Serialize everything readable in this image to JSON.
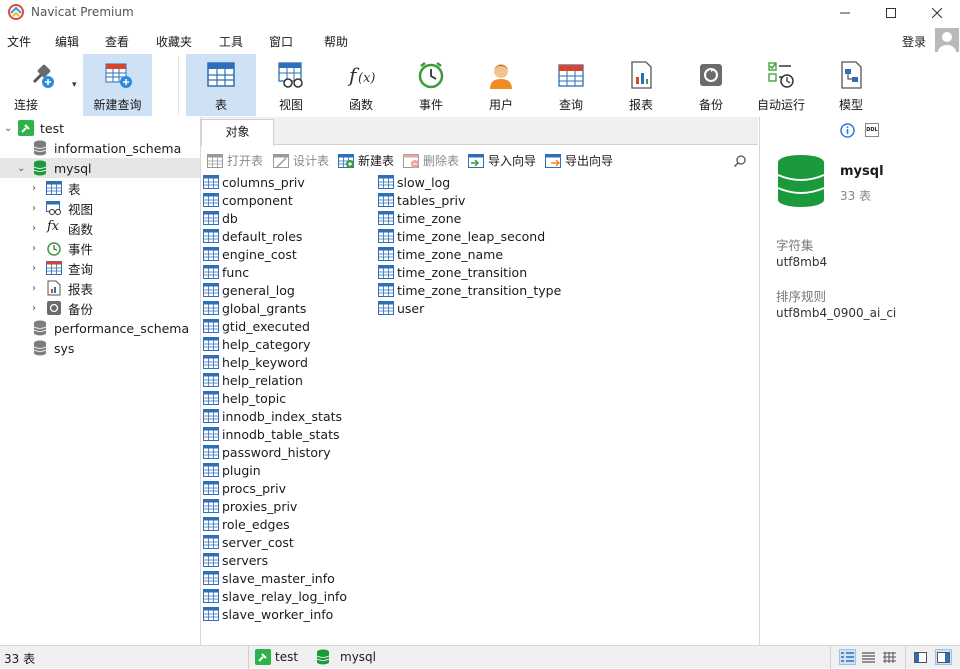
{
  "app": {
    "title": "Navicat Premium"
  },
  "menu": {
    "items": [
      "文件",
      "编辑",
      "查看",
      "收藏夹",
      "工具",
      "窗口",
      "帮助"
    ],
    "login": "登录"
  },
  "toolbar": {
    "connect": "连接",
    "new_query": "新建查询",
    "items": [
      "表",
      "视图",
      "函数",
      "事件",
      "用户",
      "查询",
      "报表",
      "备份",
      "自动运行",
      "模型"
    ]
  },
  "sidebar": {
    "connection": "test",
    "databases": [
      "information_schema",
      "mysql",
      "performance_schema",
      "sys"
    ],
    "mysql_children": [
      "表",
      "视图",
      "函数",
      "事件",
      "查询",
      "报表",
      "备份"
    ]
  },
  "tab": {
    "label": "对象"
  },
  "objbar": {
    "open": "打开表",
    "design": "设计表",
    "new": "新建表",
    "delete": "删除表",
    "import": "导入向导",
    "export": "导出向导"
  },
  "tables": {
    "col1": [
      "columns_priv",
      "component",
      "db",
      "default_roles",
      "engine_cost",
      "func",
      "general_log",
      "global_grants",
      "gtid_executed",
      "help_category",
      "help_keyword",
      "help_relation",
      "help_topic",
      "innodb_index_stats",
      "innodb_table_stats",
      "password_history",
      "plugin",
      "procs_priv",
      "proxies_priv",
      "role_edges",
      "server_cost",
      "servers",
      "slave_master_info",
      "slave_relay_log_info",
      "slave_worker_info"
    ],
    "col2": [
      "slow_log",
      "tables_priv",
      "time_zone",
      "time_zone_leap_second",
      "time_zone_name",
      "time_zone_transition",
      "time_zone_transition_type",
      "user"
    ]
  },
  "info": {
    "name": "mysql",
    "count": "33 表",
    "charset_label": "字符集",
    "charset": "utf8mb4",
    "collation_label": "排序规则",
    "collation": "utf8mb4_0900_ai_ci",
    "ddl_icon": "DDL"
  },
  "status": {
    "count": "33 表",
    "connection": "test",
    "database": "mysql"
  },
  "colors": {
    "accent": "#cfe2f5",
    "db_green": "#1a9a3a",
    "table_blue": "#2e6fb7",
    "connection_green": "#2db34a"
  }
}
